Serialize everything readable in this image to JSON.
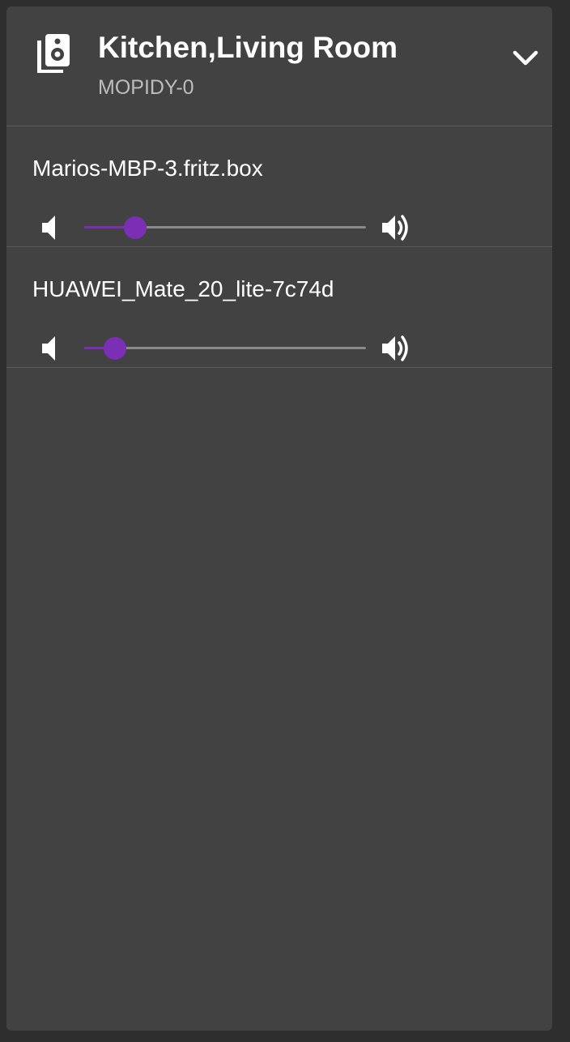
{
  "group": {
    "title": "Kitchen,Living Room",
    "subtitle": "MOPIDY-0",
    "icon": "speaker-icon",
    "expand_icon": "chevron-down-icon"
  },
  "clients": [
    {
      "name": "Marios-MBP-3.fritz.box",
      "volume": 18
    },
    {
      "name": "HUAWEI_Mate_20_lite-7c74d",
      "volume": 11
    }
  ],
  "colors": {
    "panel": "#424242",
    "background": "#2e2e2e",
    "accent": "#7b2fb5",
    "rail": "#8a8a8a",
    "subtitle": "#bdbdbd"
  }
}
